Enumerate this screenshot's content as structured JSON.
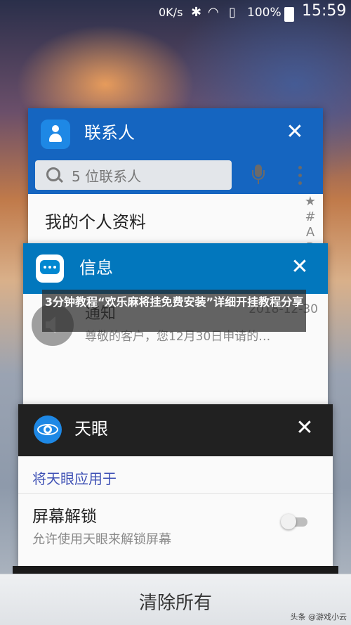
{
  "status_bar": {
    "net_speed": "0K/s",
    "battery_pct": "100%",
    "time": "15:59"
  },
  "recents": [
    {
      "app": "联系人",
      "search_placeholder": "5 位联系人",
      "first_row": "我的个人资料",
      "index_letters": [
        "★",
        "#",
        "A",
        "B"
      ]
    },
    {
      "app": "信息",
      "sender": "通知",
      "date": "2018-12-30",
      "preview": "尊敬的客户，您12月30日申请的…"
    },
    {
      "app": "天眼",
      "section": "将天眼应用于",
      "setting_title": "屏幕解锁",
      "setting_desc": "允许使用天眼来解锁屏幕",
      "toggle_on": false
    }
  ],
  "caption": "3分钟教程“欢乐麻将挂免费安装”详细开挂教程分享",
  "clear_all_label": "清除所有",
  "watermark": "头条 @游戏小云"
}
